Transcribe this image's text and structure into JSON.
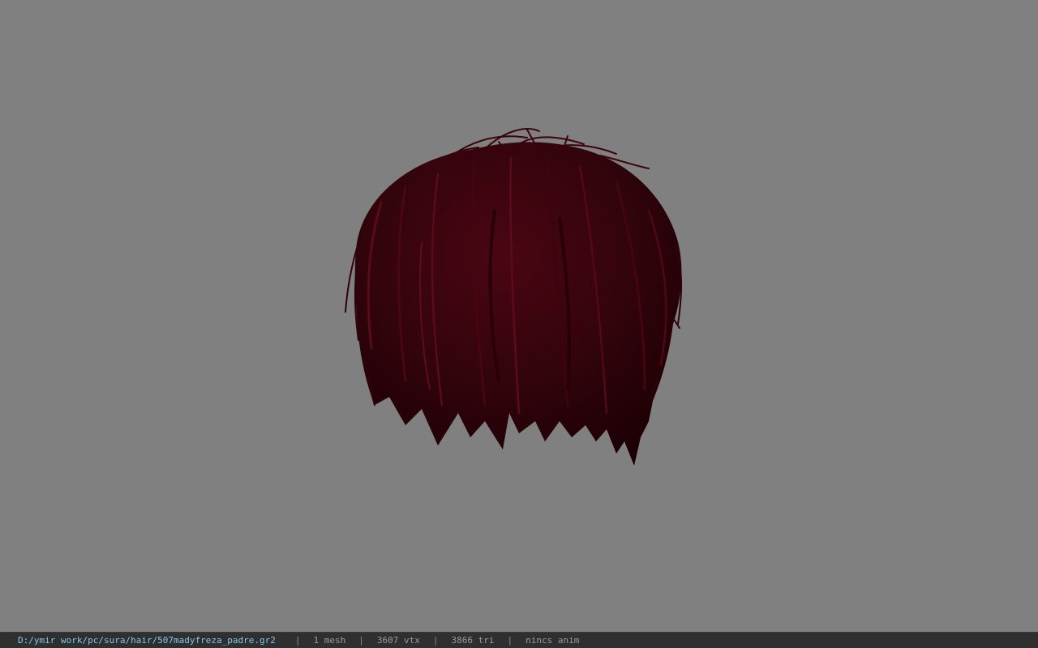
{
  "viewport": {
    "background_color": "#808080",
    "model": {
      "name": "hair-mesh",
      "base_color": "#2a0008",
      "highlight_color": "#5a0a18"
    }
  },
  "status_bar": {
    "file_path": "D:/ymir work/pc/sura/hair/507madyfreza_padre.gr2",
    "separator": "|",
    "mesh_count": "1 mesh",
    "vertex_count": "3607 vtx",
    "triangle_count": "3866 tri",
    "anim_status": "nincs anim"
  }
}
